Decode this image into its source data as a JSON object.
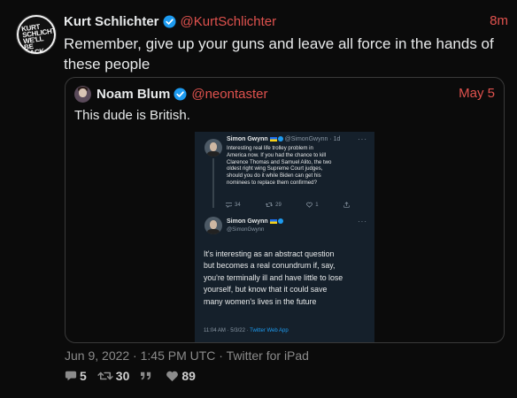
{
  "author": {
    "avatar_text": "KURT SCHLICHTER WE'LL BE BACK",
    "name": "Kurt Schlichter",
    "handle": "@KurtSchlichter",
    "time": "8m",
    "verified_icon": "verified-badge-icon"
  },
  "tweet_text": "Remember, give up your guns and leave all force in the hands of these people",
  "quoted": {
    "name": "Noam Blum",
    "handle": "@neontaster",
    "date": "May 5",
    "text": "This dude is British.",
    "screenshot": {
      "first": {
        "name": "Simon Gwynn",
        "handle_time": "@SimonGwynn · 1d",
        "text_lines": [
          "Interesting real life trolley problem in",
          "America now. If you had the chance to kill",
          "Clarence Thomas and Samuel Alito, the two",
          "oldest right wing Supreme Court judges,",
          "should you do it while Biden can get his",
          "nominees to replace them confirmed?"
        ],
        "replies": "34",
        "retweets": "29",
        "likes": "1"
      },
      "second": {
        "name": "Simon Gwynn",
        "handle": "@SimonGwynn",
        "text_lines": [
          "It's interesting as an abstract question",
          "but becomes a real conundrum if, say,",
          "you're terminally ill and have little to lose",
          "yourself, but know that it could save",
          "many women's lives in the future"
        ],
        "timestamp": "11:04 AM · 5/3/22 · ",
        "app": "Twitter Web App"
      }
    }
  },
  "meta": "Jun 9, 2022 · 1:45 PM UTC · Twitter for iPad",
  "stats": {
    "replies": "5",
    "retweets": "30",
    "likes": "89"
  },
  "colors": {
    "accent": "#e0524e",
    "verified": "#1d9bf0",
    "background": "#0b0b0b"
  }
}
